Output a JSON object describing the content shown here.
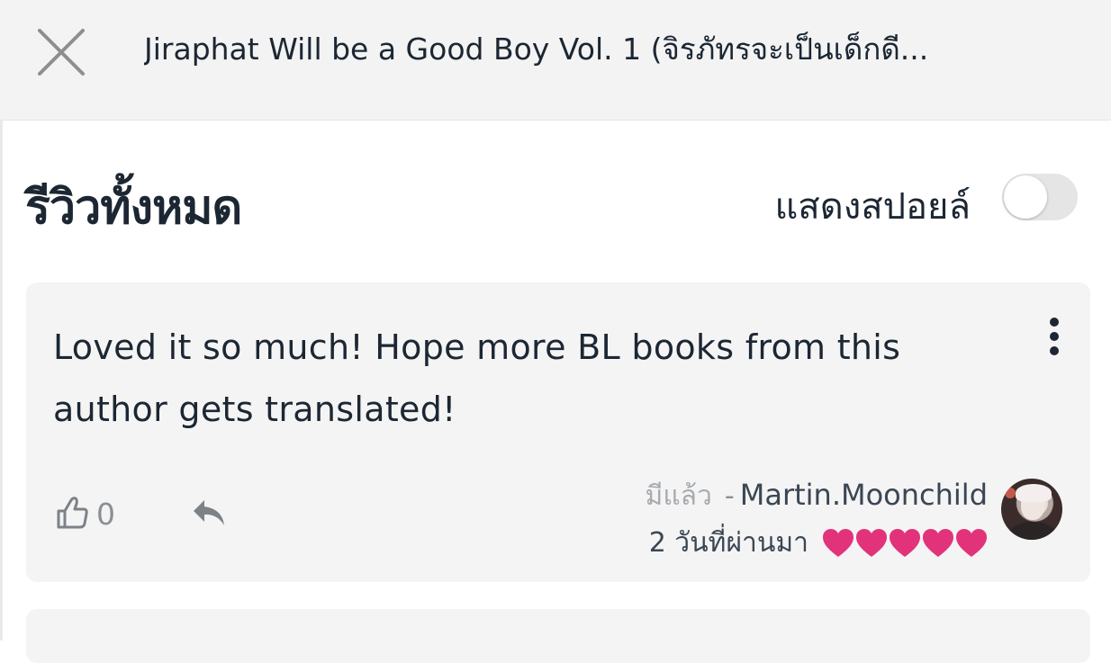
{
  "header": {
    "title": "Jiraphat Will be a Good Boy Vol. 1 (จิรภัทรจะเป็นเด็กดี...",
    "close_icon": "close-icon"
  },
  "reviews_section": {
    "title": "รีวิวทั้งหมด",
    "spoiler_toggle": {
      "label": "แสดงสปอยล์",
      "on": false
    }
  },
  "reviews": [
    {
      "text": "Loved it so much! Hope more BL books from this author gets translated!",
      "like_count": "0",
      "owned_label": "มีแล้ว",
      "separator": "-",
      "username": "Martin.Moonchild",
      "time": "2 วันที่ผ่านมา",
      "rating": 5,
      "rating_max": 5,
      "heart_color": "#e2337a",
      "icons": {
        "like": "thumbs-up-icon",
        "reply": "reply-icon",
        "more": "more-vertical-icon"
      }
    }
  ],
  "colors": {
    "header_bg": "#f3f3f3",
    "card_bg": "#f4f4f4",
    "text": "#1c2733",
    "heart": "#e2337a"
  }
}
